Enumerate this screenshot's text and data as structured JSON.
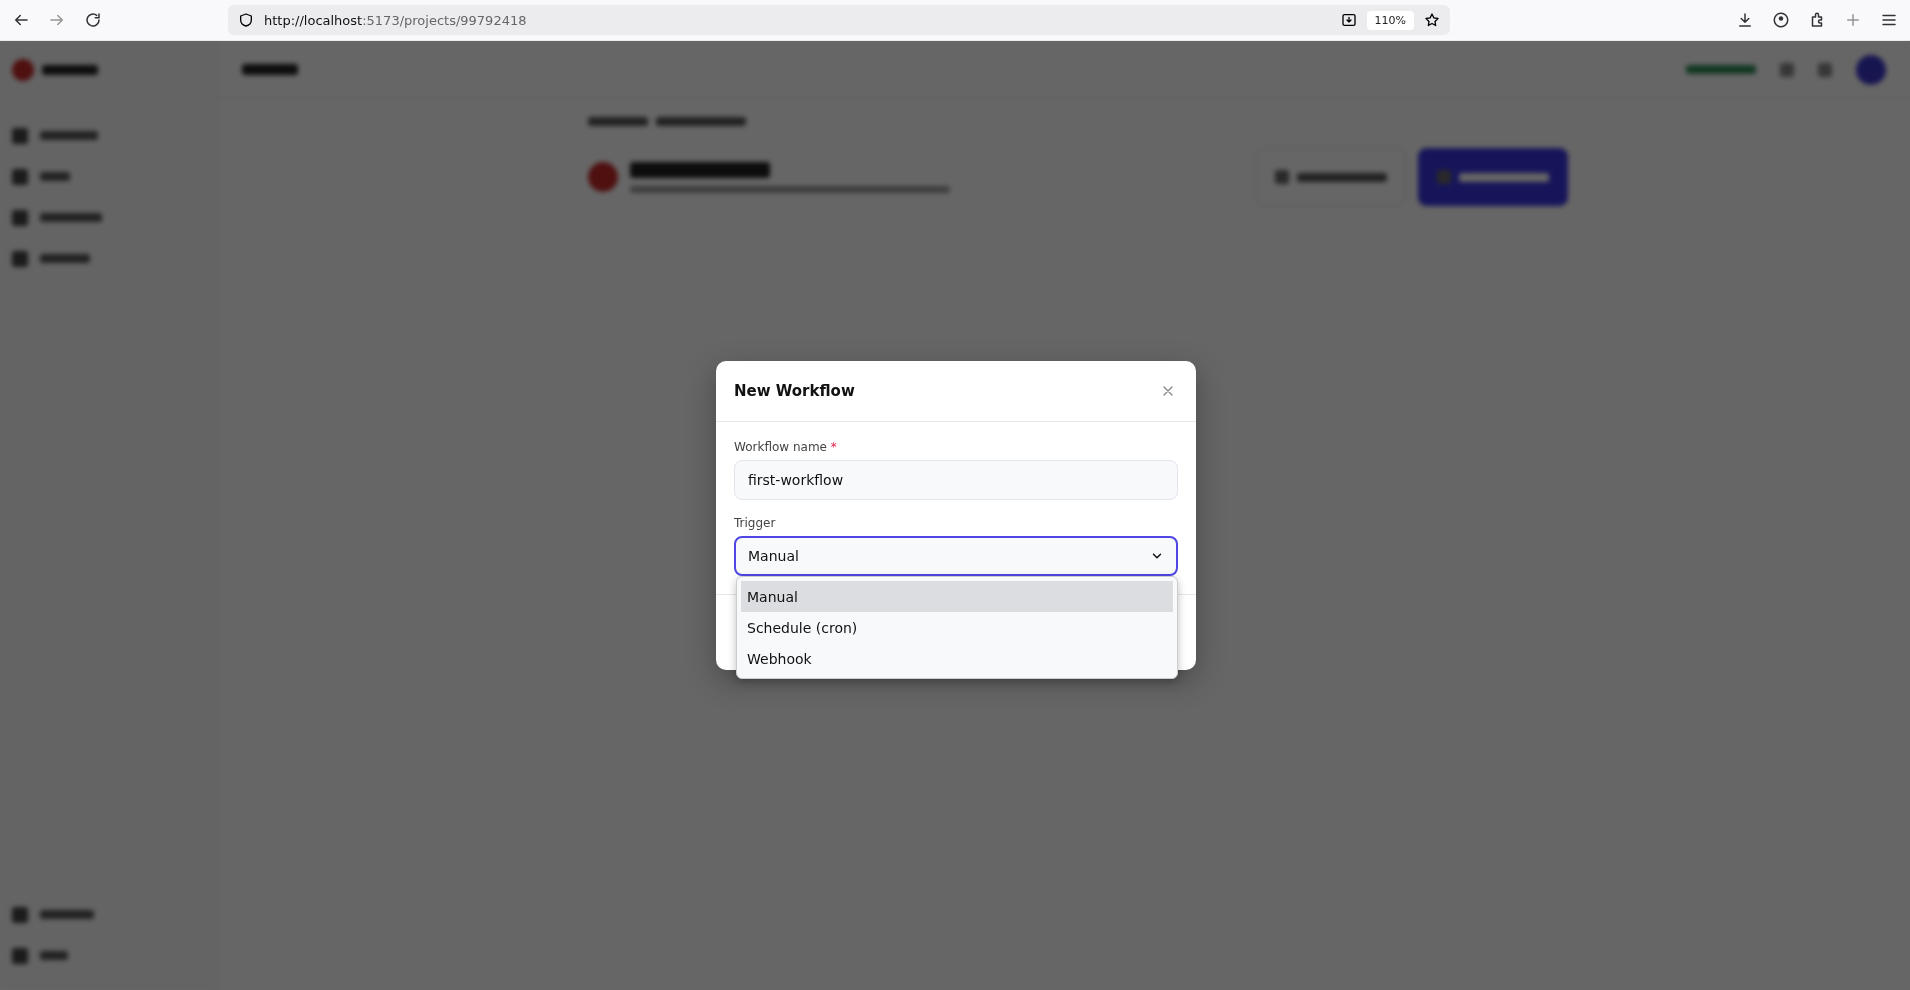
{
  "browser": {
    "url_host": "http://localhost",
    "url_rest": ":5173/projects/99792418",
    "zoom": "110%"
  },
  "dialog": {
    "title": "New Workflow",
    "name_field": {
      "label": "Workflow name",
      "required_mark": "*",
      "value": "first-workflow"
    },
    "trigger_field": {
      "label": "Trigger",
      "value": "Manual",
      "open": true,
      "options": [
        {
          "label": "Manual",
          "selected": true
        },
        {
          "label": "Schedule (cron)",
          "selected": false
        },
        {
          "label": "Webhook",
          "selected": false
        }
      ]
    }
  }
}
